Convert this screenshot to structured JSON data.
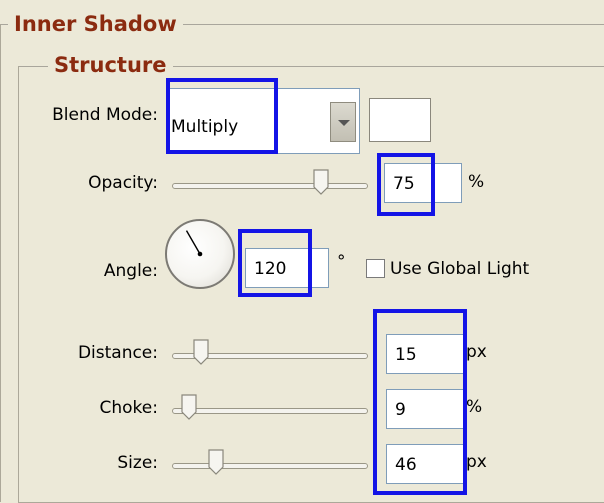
{
  "group_outer": {
    "title": "Inner Shadow"
  },
  "group_inner": {
    "title": "Structure"
  },
  "blend_mode": {
    "label": "Blend Mode:",
    "value": "Multiply",
    "color_swatch": "#ffffff"
  },
  "opacity": {
    "label": "Opacity:",
    "value": "75",
    "unit": "%",
    "slider_fraction": 0.75
  },
  "angle": {
    "label": "Angle:",
    "value": "120",
    "unit": "°",
    "degrees": 120,
    "global_light_label": "Use Global Light",
    "global_light_checked": false
  },
  "distance": {
    "label": "Distance:",
    "value": "15",
    "unit": "px",
    "slider_fraction": 0.15
  },
  "choke": {
    "label": "Choke:",
    "value": "9",
    "unit": "%",
    "slider_fraction": 0.09
  },
  "size": {
    "label": "Size:",
    "value": "46",
    "unit": "px",
    "slider_fraction": 0.18
  },
  "colors": {
    "highlight": "#1414e6",
    "title": "#8b2b10",
    "background": "#ece9d8"
  }
}
